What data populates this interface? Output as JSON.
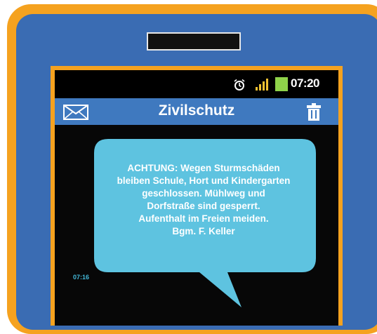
{
  "status_bar": {
    "time": "07:20",
    "icons": [
      "alarm-icon",
      "signal-icon",
      "battery-icon"
    ]
  },
  "header": {
    "title": "Zivilschutz",
    "left_icon": "mail-icon",
    "right_icon": "trash-icon"
  },
  "message": {
    "lines": [
      "ACHTUNG: Wegen Sturmschäden",
      "bleiben Schule, Hort und Kindergarten",
      "geschlossen. Mühlweg und",
      "Dorfstraße sind gesperrt.",
      "Aufenthalt im Freien meiden.",
      "Bgm. F. Keller"
    ],
    "time": "07:16"
  },
  "colors": {
    "frame_orange": "#f5a21f",
    "phone_blue": "#3a6cb3",
    "header_blue": "#3f79bf",
    "bubble": "#5ec3e0",
    "screen": "#070707"
  }
}
